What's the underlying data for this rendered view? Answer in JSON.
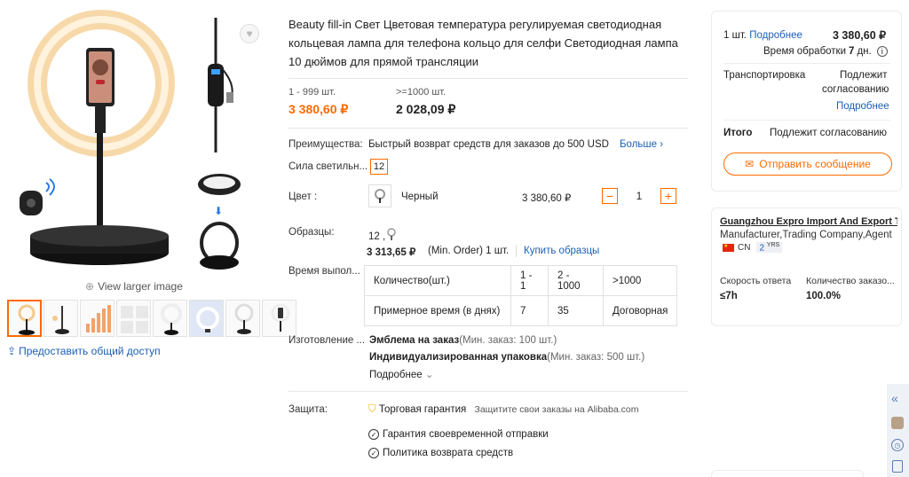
{
  "gallery": {
    "view_larger": "View larger image",
    "share": "Предоставить общий доступ",
    "thumb_count": 8
  },
  "product": {
    "title": "Beauty fill-in Свет Цветовая температура регулируемая светодиодная кольцевая лампа для телефона кольцо для селфи Светодиодная лампа 10 дюймов для прямой трансляции",
    "tiers": [
      {
        "range": "1 - 999 шт.",
        "price": "3 380,60 ₽"
      },
      {
        "range": ">=1000 шт.",
        "price": "2 028,09 ₽"
      }
    ],
    "benefits": {
      "label": "Преимущества:",
      "text": "Быстрый возврат средств для заказов до 500 USD",
      "more": "Больше"
    },
    "power": {
      "label": "Сила светильн...",
      "value": "12"
    },
    "color": {
      "label": "Цвет :",
      "name": "Черный",
      "price": "3 380,60 ₽",
      "qty": "1"
    },
    "samples": {
      "label": "Образцы:",
      "spec": "12 ,",
      "price": "3 313,65 ₽",
      "min_order": "(Min. Order) 1 шт.",
      "buy": "Купить образцы"
    },
    "lead_time": {
      "label": "Время выпол...",
      "rows": [
        [
          "Количество(шт.)",
          "1 - 1",
          "2 - 1000",
          ">1000"
        ],
        [
          "Примерное время (в днях)",
          "7",
          "35",
          "Договорная"
        ]
      ]
    },
    "custom": {
      "label": "Изготовление ...",
      "line1_bold": "Эмблема на заказ",
      "line1_note": "(Мин. заказ: 100 шт.)",
      "line2_bold": "Индивидуализированная упаковка",
      "line2_note": "(Мин. заказ: 500 шт.)",
      "more": "Подробнее"
    },
    "protection": {
      "label": "Защита:",
      "assurance": "Торговая гарантия",
      "assurance_note": "Защитите свои заказы на Alibaba.com",
      "item1": "Гарантия своевременной отправки",
      "item2": "Политика возврата средств"
    }
  },
  "order_card": {
    "qty": "1 шт.",
    "details_link": "Подробнее",
    "price": "3 380,60 ₽",
    "processing_label": "Время обработки",
    "processing_value": "7",
    "processing_unit": "дн.",
    "shipping_label": "Транспортировка",
    "shipping_value_1": "Подлежит",
    "shipping_value_2": "согласованию",
    "shipping_link": "Подробнее",
    "total_label": "Итого",
    "total_value": "Подлежит согласованию",
    "send_button": "Отправить сообщение"
  },
  "supplier": {
    "name": "Guangzhou Expro Import And Export Tr...",
    "type": "Manufacturer,Trading Company,Agent",
    "country": "CN",
    "years": "2",
    "years_unit": "YRS",
    "response_label": "Скорость ответа",
    "response_value": "≤7h",
    "orders_label": "Количество заказо...",
    "orders_value": "100.0%"
  },
  "colors": {
    "accent": "#ff6a00",
    "link": "#1a5fb4"
  }
}
